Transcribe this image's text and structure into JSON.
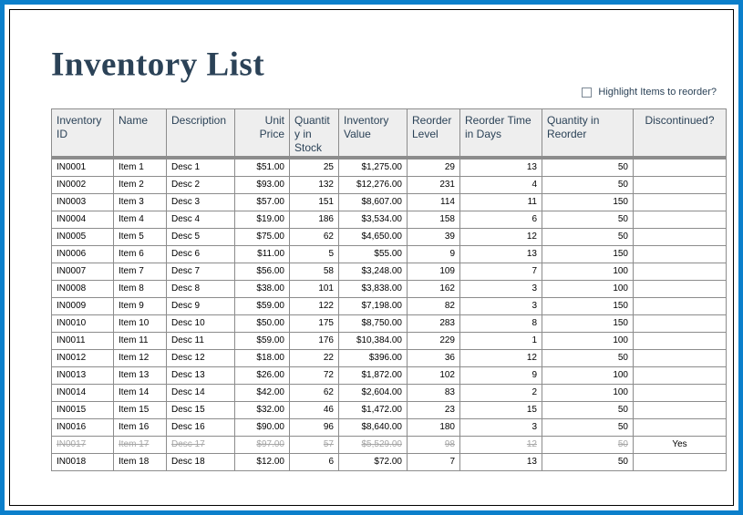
{
  "header": {
    "title": "Inventory List",
    "highlight_checkbox_label": "Highlight Items to reorder?",
    "highlight_checkbox_checked": false
  },
  "colors": {
    "frame_blue": "#0b7fcb",
    "title_text": "#2b4257",
    "header_fill": "#eeeeee",
    "grid_line": "#8c8c8c",
    "discontinued_text": "#a6a6a6"
  },
  "table": {
    "columns": [
      {
        "label": "Inventory ID",
        "align": "left"
      },
      {
        "label": "Name",
        "align": "left"
      },
      {
        "label": "Description",
        "align": "left"
      },
      {
        "label": "Unit Price",
        "align": "right"
      },
      {
        "label": "Quantity in Stock",
        "align": "left"
      },
      {
        "label": "Inventory Value",
        "align": "left"
      },
      {
        "label": "Reorder Level",
        "align": "left"
      },
      {
        "label": "Reorder Time in Days",
        "align": "left"
      },
      {
        "label": "Quantity in Reorder",
        "align": "left"
      },
      {
        "label": "Discontinued?",
        "align": "center"
      }
    ],
    "rows": [
      {
        "id": "IN0001",
        "name": "Item 1",
        "description": "Desc 1",
        "unit_price": "$51.00",
        "qty_in_stock": "25",
        "inventory_value": "$1,275.00",
        "reorder_level": "29",
        "reorder_time_days": "13",
        "qty_in_reorder": "50",
        "discontinued": "",
        "is_discontinued": false
      },
      {
        "id": "IN0002",
        "name": "Item 2",
        "description": "Desc 2",
        "unit_price": "$93.00",
        "qty_in_stock": "132",
        "inventory_value": "$12,276.00",
        "reorder_level": "231",
        "reorder_time_days": "4",
        "qty_in_reorder": "50",
        "discontinued": "",
        "is_discontinued": false
      },
      {
        "id": "IN0003",
        "name": "Item 3",
        "description": "Desc 3",
        "unit_price": "$57.00",
        "qty_in_stock": "151",
        "inventory_value": "$8,607.00",
        "reorder_level": "114",
        "reorder_time_days": "11",
        "qty_in_reorder": "150",
        "discontinued": "",
        "is_discontinued": false
      },
      {
        "id": "IN0004",
        "name": "Item 4",
        "description": "Desc 4",
        "unit_price": "$19.00",
        "qty_in_stock": "186",
        "inventory_value": "$3,534.00",
        "reorder_level": "158",
        "reorder_time_days": "6",
        "qty_in_reorder": "50",
        "discontinued": "",
        "is_discontinued": false
      },
      {
        "id": "IN0005",
        "name": "Item 5",
        "description": "Desc 5",
        "unit_price": "$75.00",
        "qty_in_stock": "62",
        "inventory_value": "$4,650.00",
        "reorder_level": "39",
        "reorder_time_days": "12",
        "qty_in_reorder": "50",
        "discontinued": "",
        "is_discontinued": false
      },
      {
        "id": "IN0006",
        "name": "Item 6",
        "description": "Desc 6",
        "unit_price": "$11.00",
        "qty_in_stock": "5",
        "inventory_value": "$55.00",
        "reorder_level": "9",
        "reorder_time_days": "13",
        "qty_in_reorder": "150",
        "discontinued": "",
        "is_discontinued": false
      },
      {
        "id": "IN0007",
        "name": "Item 7",
        "description": "Desc 7",
        "unit_price": "$56.00",
        "qty_in_stock": "58",
        "inventory_value": "$3,248.00",
        "reorder_level": "109",
        "reorder_time_days": "7",
        "qty_in_reorder": "100",
        "discontinued": "",
        "is_discontinued": false
      },
      {
        "id": "IN0008",
        "name": "Item 8",
        "description": "Desc 8",
        "unit_price": "$38.00",
        "qty_in_stock": "101",
        "inventory_value": "$3,838.00",
        "reorder_level": "162",
        "reorder_time_days": "3",
        "qty_in_reorder": "100",
        "discontinued": "",
        "is_discontinued": false
      },
      {
        "id": "IN0009",
        "name": "Item 9",
        "description": "Desc 9",
        "unit_price": "$59.00",
        "qty_in_stock": "122",
        "inventory_value": "$7,198.00",
        "reorder_level": "82",
        "reorder_time_days": "3",
        "qty_in_reorder": "150",
        "discontinued": "",
        "is_discontinued": false
      },
      {
        "id": "IN0010",
        "name": "Item 10",
        "description": "Desc 10",
        "unit_price": "$50.00",
        "qty_in_stock": "175",
        "inventory_value": "$8,750.00",
        "reorder_level": "283",
        "reorder_time_days": "8",
        "qty_in_reorder": "150",
        "discontinued": "",
        "is_discontinued": false
      },
      {
        "id": "IN0011",
        "name": "Item 11",
        "description": "Desc 11",
        "unit_price": "$59.00",
        "qty_in_stock": "176",
        "inventory_value": "$10,384.00",
        "reorder_level": "229",
        "reorder_time_days": "1",
        "qty_in_reorder": "100",
        "discontinued": "",
        "is_discontinued": false
      },
      {
        "id": "IN0012",
        "name": "Item 12",
        "description": "Desc 12",
        "unit_price": "$18.00",
        "qty_in_stock": "22",
        "inventory_value": "$396.00",
        "reorder_level": "36",
        "reorder_time_days": "12",
        "qty_in_reorder": "50",
        "discontinued": "",
        "is_discontinued": false
      },
      {
        "id": "IN0013",
        "name": "Item 13",
        "description": "Desc 13",
        "unit_price": "$26.00",
        "qty_in_stock": "72",
        "inventory_value": "$1,872.00",
        "reorder_level": "102",
        "reorder_time_days": "9",
        "qty_in_reorder": "100",
        "discontinued": "",
        "is_discontinued": false
      },
      {
        "id": "IN0014",
        "name": "Item 14",
        "description": "Desc 14",
        "unit_price": "$42.00",
        "qty_in_stock": "62",
        "inventory_value": "$2,604.00",
        "reorder_level": "83",
        "reorder_time_days": "2",
        "qty_in_reorder": "100",
        "discontinued": "",
        "is_discontinued": false
      },
      {
        "id": "IN0015",
        "name": "Item 15",
        "description": "Desc 15",
        "unit_price": "$32.00",
        "qty_in_stock": "46",
        "inventory_value": "$1,472.00",
        "reorder_level": "23",
        "reorder_time_days": "15",
        "qty_in_reorder": "50",
        "discontinued": "",
        "is_discontinued": false
      },
      {
        "id": "IN0016",
        "name": "Item 16",
        "description": "Desc 16",
        "unit_price": "$90.00",
        "qty_in_stock": "96",
        "inventory_value": "$8,640.00",
        "reorder_level": "180",
        "reorder_time_days": "3",
        "qty_in_reorder": "50",
        "discontinued": "",
        "is_discontinued": false
      },
      {
        "id": "IN0017",
        "name": "Item 17",
        "description": "Desc 17",
        "unit_price": "$97.00",
        "qty_in_stock": "57",
        "inventory_value": "$5,529.00",
        "reorder_level": "98",
        "reorder_time_days": "12",
        "qty_in_reorder": "50",
        "discontinued": "Yes",
        "is_discontinued": true
      },
      {
        "id": "IN0018",
        "name": "Item 18",
        "description": "Desc 18",
        "unit_price": "$12.00",
        "qty_in_stock": "6",
        "inventory_value": "$72.00",
        "reorder_level": "7",
        "reorder_time_days": "13",
        "qty_in_reorder": "50",
        "discontinued": "",
        "is_discontinued": false
      }
    ]
  }
}
